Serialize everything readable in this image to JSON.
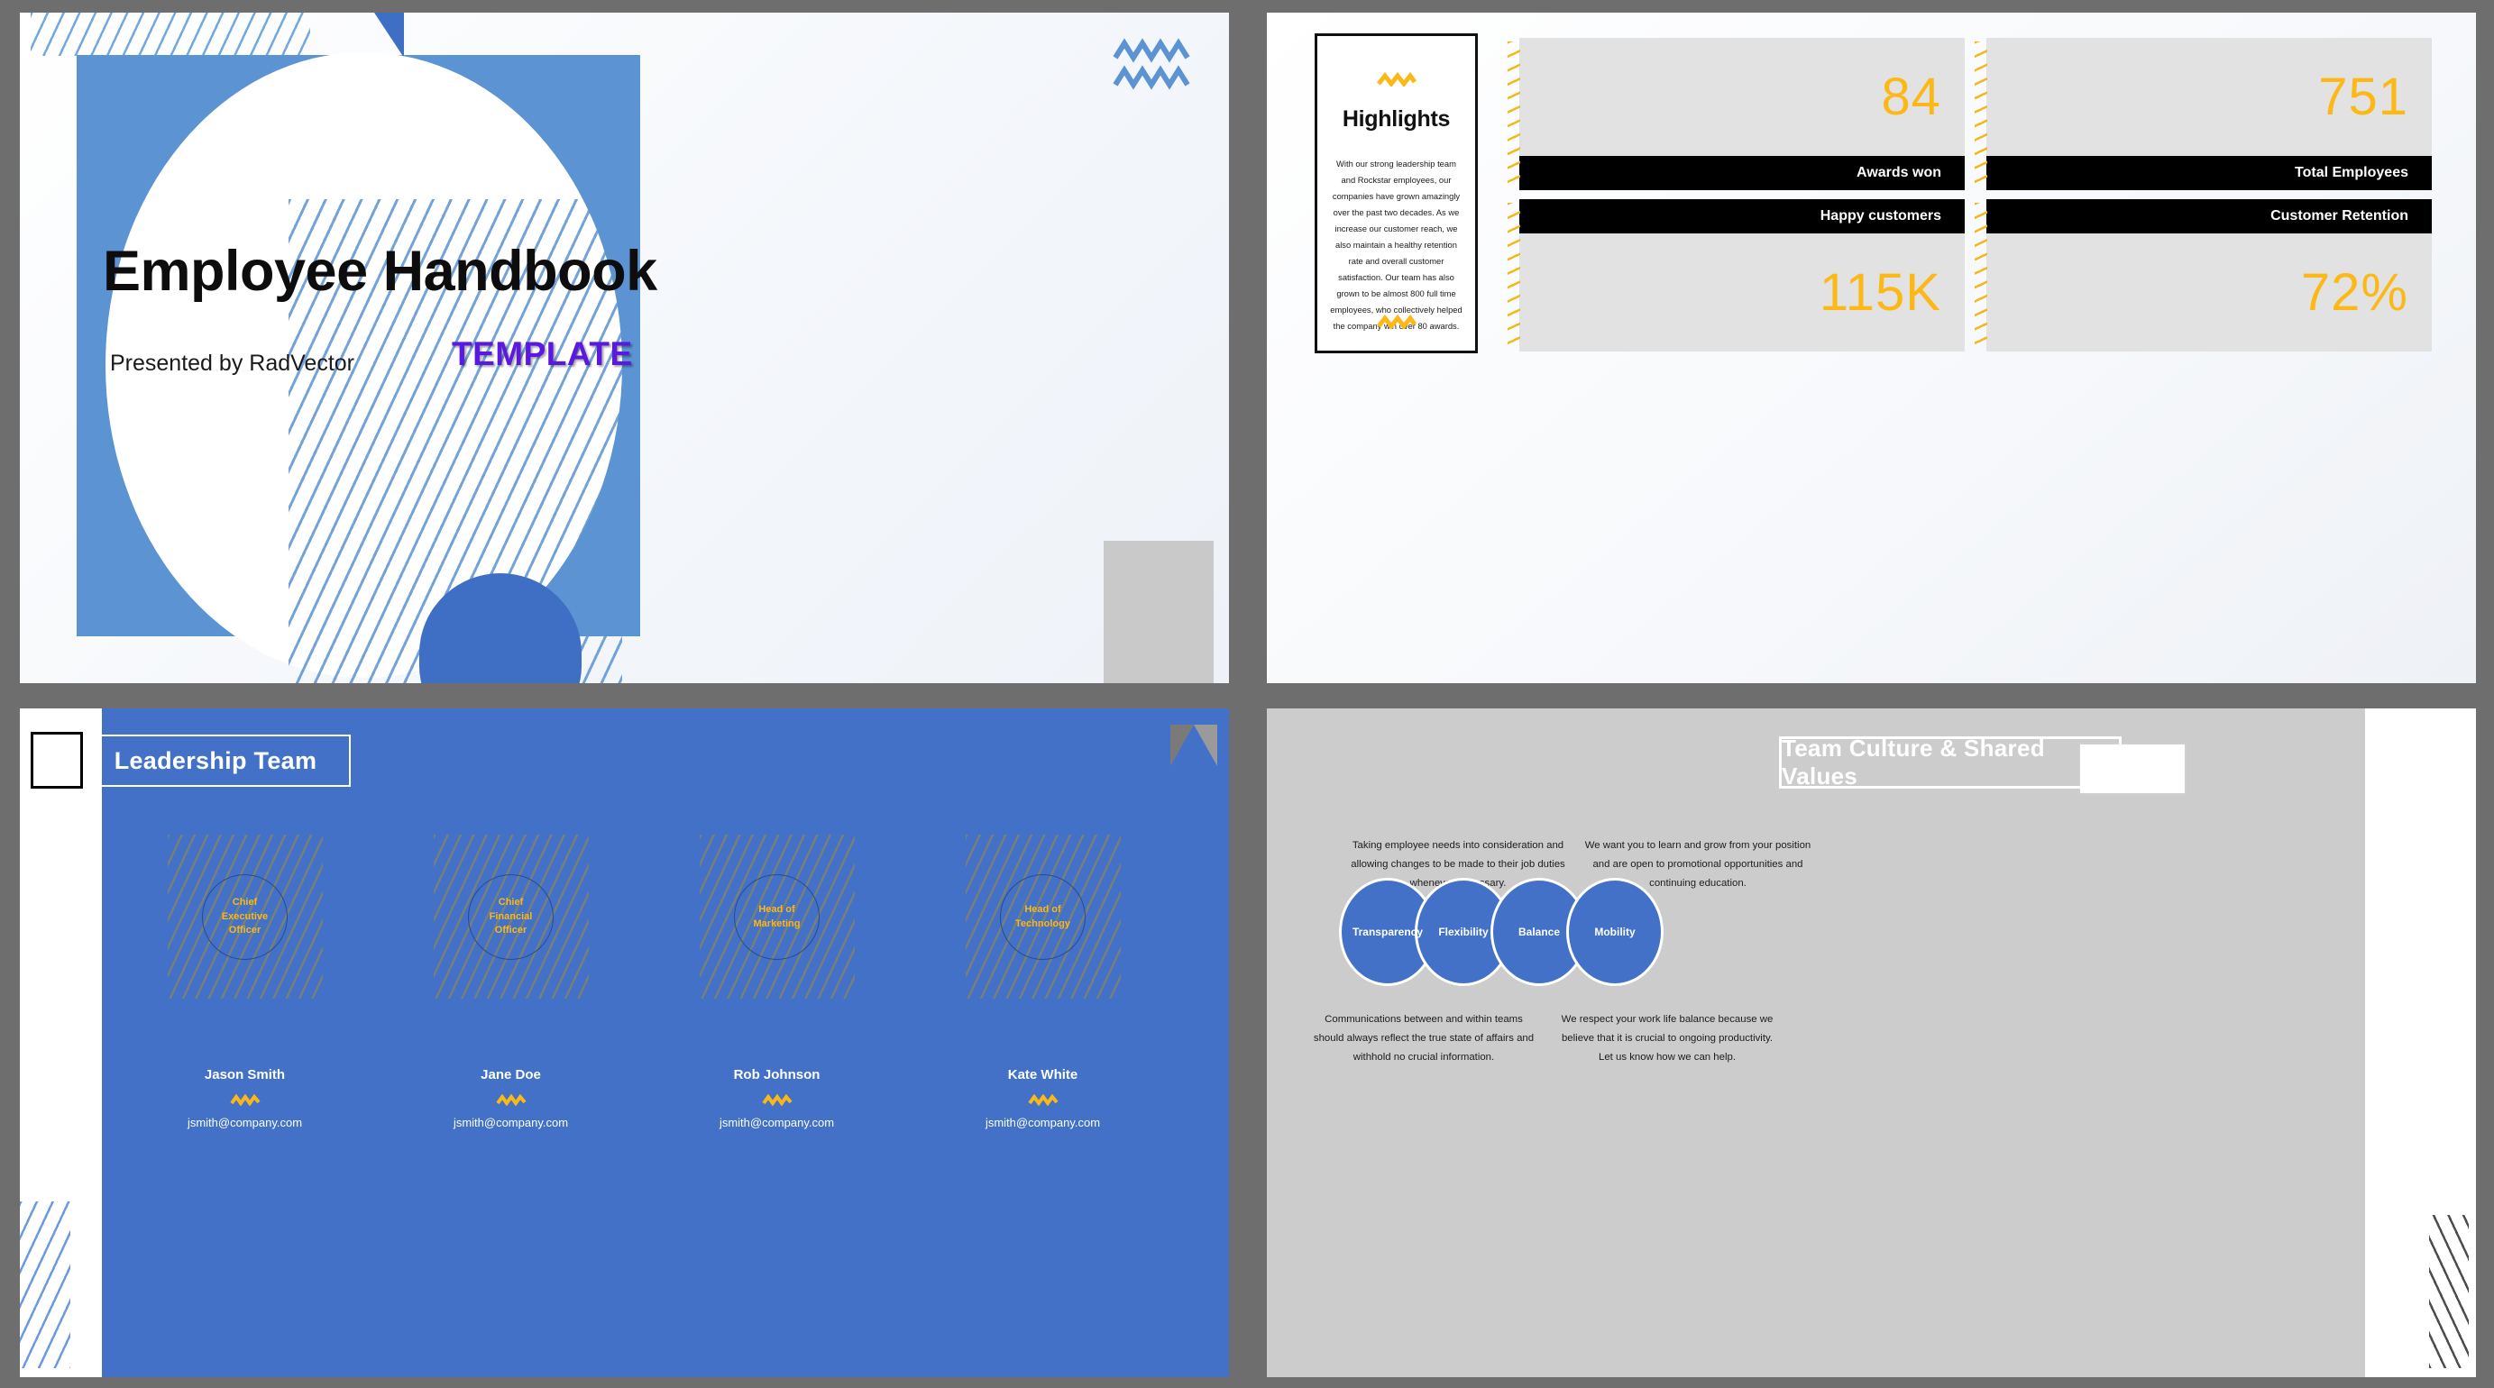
{
  "colors": {
    "accent_blue": "#4271c7",
    "light_blue": "#5b93d3",
    "yellow": "#fcb817",
    "purple": "#5b18e0",
    "black": "#000000",
    "gray_panel": "#e2e2e2",
    "gray_slide_bg": "#cccccc",
    "canvas_bg": "#6e6e6e"
  },
  "slides": {
    "title_slide": {
      "name": "title-slide",
      "title": "Employee Handbook",
      "subtitle": "Presented by RadVector",
      "badge": "TEMPLATE"
    },
    "highlights_slide": {
      "name": "highlights-slide",
      "card_title": "Highlights",
      "card_body": "With our strong leadership team and Rockstar employees, our companies have grown amazingly over the past two decades. As we increase our customer reach, we also maintain a healthy retention rate and overall customer satisfaction. Our team has also grown to be almost 800 full time employees, who collectively helped the company win over 80 awards.",
      "stats": [
        {
          "value": "84",
          "label": "Awards won",
          "label_position": "bottom"
        },
        {
          "value": "751",
          "label": "Total Employees",
          "label_position": "bottom"
        },
        {
          "value": "115K",
          "label": "Happy customers",
          "label_position": "top"
        },
        {
          "value": "72%",
          "label": "Customer Retention",
          "label_position": "top"
        }
      ]
    },
    "leadership_slide": {
      "name": "leadership-team-slide",
      "title": "Leadership Team",
      "members": [
        {
          "role": "Chief\nExecutive\nOfficer",
          "role_lines": [
            "Chief",
            "Executive",
            "Officer"
          ],
          "name": "Jason Smith",
          "email": "jsmith@company.com"
        },
        {
          "role": "Chief\nFinancial\nOfficer",
          "role_lines": [
            "Chief",
            "Financial",
            "Officer"
          ],
          "name": "Jane Doe",
          "email": "jsmith@company.com"
        },
        {
          "role": "Head of\nMarketing",
          "role_lines": [
            "Head of",
            "Marketing"
          ],
          "name": "Rob Johnson",
          "email": "jsmith@company.com"
        },
        {
          "role": "Head of\nTechnology",
          "role_lines": [
            "Head of",
            "Technology"
          ],
          "name": "Kate White",
          "email": "jsmith@company.com"
        }
      ]
    },
    "culture_slide": {
      "name": "team-culture-slide",
      "title": "Team Culture & Shared Values",
      "values": [
        "Transparency",
        "Flexibility",
        "Balance",
        "Mobility"
      ],
      "captions": {
        "top_left": "Taking employee needs into consideration and allowing changes to be made to their job duties whenever  necessary.",
        "top_right": "We want you to learn and grow from your position and are open to promotional opportunities and continuing education.",
        "bottom_left": "Communications between and within teams should always reflect the true state of affairs and withhold no crucial information.",
        "bottom_right": "We respect your work life balance because we believe that it is crucial to ongoing productivity. Let us know how we can help."
      }
    }
  }
}
